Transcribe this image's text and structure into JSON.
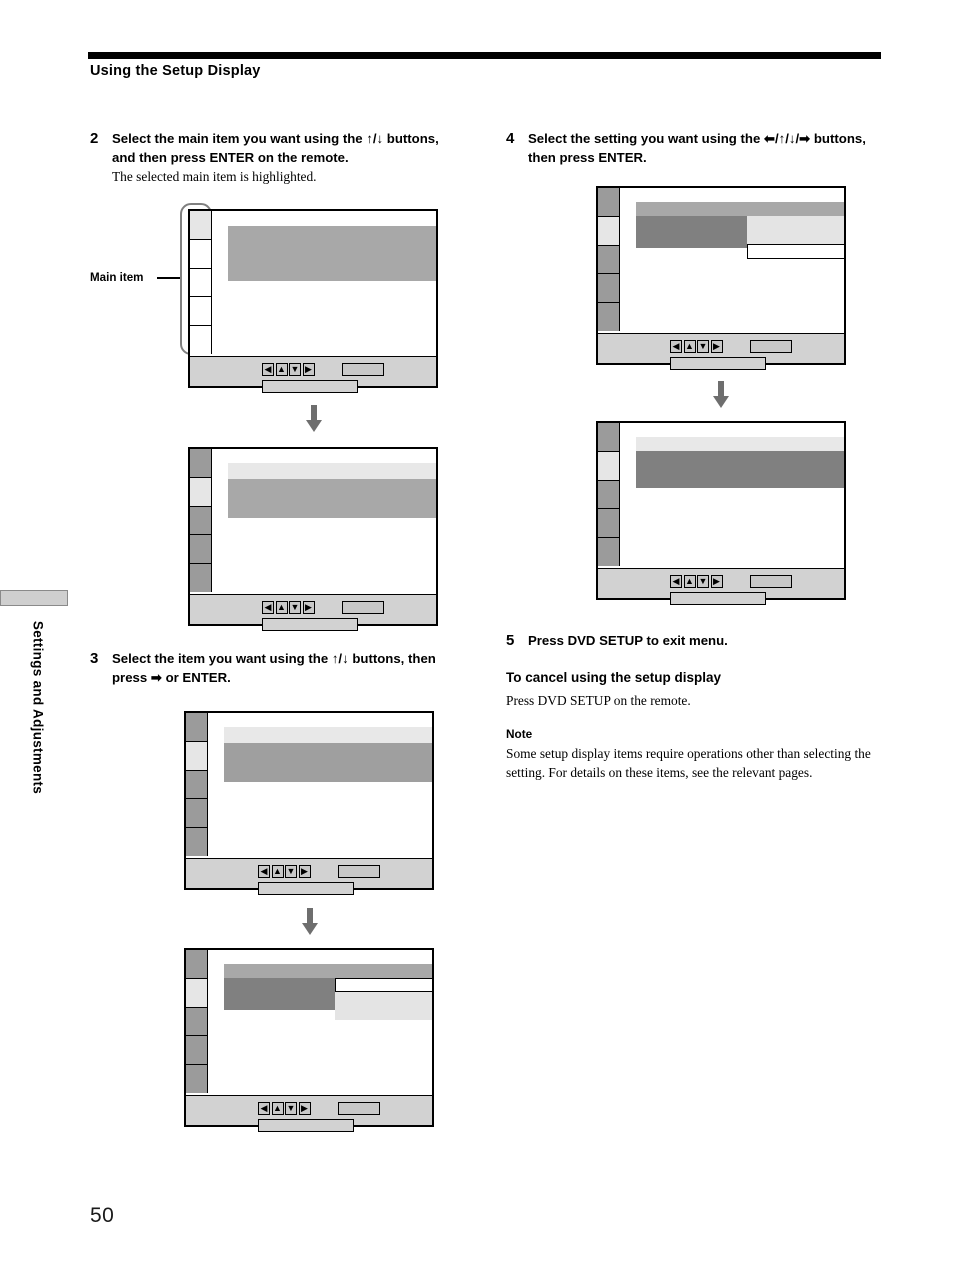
{
  "page": {
    "header_title": "Using the Setup Display",
    "page_number": "50",
    "side_tab_label": "Settings and Adjustments"
  },
  "callout": {
    "main_item_label": "Main item"
  },
  "steps": [
    {
      "number": "2",
      "head_parts": [
        "Select the main item you want using the ",
        "↑",
        "/",
        "↓",
        " buttons, and then press ENTER on the remote."
      ],
      "head_text": "Select the main item you want using the ↑/↓ buttons, and then press ENTER on the remote.",
      "sub_text": "The selected main item is highlighted."
    },
    {
      "number": "3",
      "head_text": "Select the item you want using the ↑/↓ buttons, then press ➡ or ENTER.",
      "sub_text": ""
    },
    {
      "number": "4",
      "head_text": "Select the setting you want using the ⬅/↑/↓/➡ buttons, then press ENTER.",
      "sub_text": ""
    },
    {
      "number": "5",
      "head_text": "Press DVD SETUP to exit menu.",
      "sub_text": ""
    }
  ],
  "cancel_section": {
    "heading": "To cancel using the setup display",
    "body": "Press DVD SETUP on the remote."
  },
  "note_section": {
    "heading": "Note",
    "body": "Some setup display items require operations other than selecting the setting.  For details on these items, see the relevant pages."
  },
  "nav_keys": [
    {
      "name": "nav-left",
      "glyph": "◀"
    },
    {
      "name": "nav-up",
      "glyph": "▲"
    },
    {
      "name": "nav-down",
      "glyph": "▼"
    },
    {
      "name": "nav-right",
      "glyph": "▶"
    }
  ],
  "colors": {
    "sidebar_gray": "#9b9b9b",
    "sidebar_selected": "#e6e6e6",
    "band_light": "#e8e8e8",
    "band_mid": "#a8a8a8",
    "band_dark": "#9f9f9f",
    "band_darker": "#808080",
    "footer_gray": "#d2d2d2",
    "flow_arrow": "#6e6e6e",
    "bracket": "#808080"
  },
  "screens": [
    {
      "id": "screen-step2-before",
      "caption": "Setup display with first main item selected, no sub-items highlighted",
      "sidebar": [
        "selected",
        "empty",
        "empty",
        "empty",
        "empty"
      ],
      "bands": [
        {
          "tone": "band_dark",
          "row": 1,
          "height": 3
        }
      ]
    },
    {
      "id": "screen-step2-after",
      "caption": "Main item highlighted, first sub row light and second row dark",
      "sidebar": [
        "gray",
        "selected",
        "gray",
        "gray",
        "gray"
      ],
      "bands": [
        {
          "tone": "band_light",
          "row": 1,
          "height": 1
        },
        {
          "tone": "band_dark",
          "row": 2,
          "height": 2
        }
      ]
    },
    {
      "id": "screen-step3-before",
      "caption": "Item list shown, second row highlighted dark",
      "sidebar": [
        "gray",
        "selected",
        "gray",
        "gray",
        "gray"
      ],
      "bands": [
        {
          "tone": "band_light",
          "row": 1,
          "height": 1
        },
        {
          "tone": "band_dark",
          "row": 2,
          "height": 2
        }
      ]
    },
    {
      "id": "screen-step3-after",
      "caption": "Item selected, setting options panel opened on right",
      "sidebar": [
        "gray",
        "selected",
        "gray",
        "gray",
        "gray"
      ],
      "bands": [
        {
          "tone": "band_mid",
          "row": 1,
          "height": 1
        },
        {
          "tone": "band_darker",
          "row": 2,
          "height": 2
        }
      ],
      "panel": "options-open-below"
    },
    {
      "id": "screen-step4-before",
      "caption": "Setting options panel with a choice outlined",
      "sidebar": [
        "gray",
        "selected",
        "gray",
        "gray",
        "gray"
      ],
      "bands": [
        {
          "tone": "band_mid",
          "row": 1,
          "height": 1
        },
        {
          "tone": "band_darker",
          "row": 2,
          "height": 2
        }
      ],
      "panel": "options-open-above"
    },
    {
      "id": "screen-step4-after",
      "caption": "Setting confirmed, row shown dark across full width",
      "sidebar": [
        "gray",
        "selected",
        "gray",
        "gray",
        "gray"
      ],
      "bands": [
        {
          "tone": "band_light",
          "row": 1,
          "height": 1
        },
        {
          "tone": "band_darker",
          "row": 2,
          "height": 2
        }
      ]
    }
  ]
}
